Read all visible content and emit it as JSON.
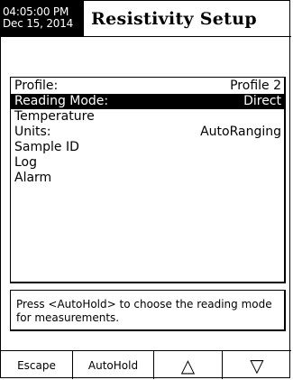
{
  "header": {
    "time": "04:05:00 PM",
    "date": "Dec 15, 2014",
    "title": "Resistivity Setup"
  },
  "menu": {
    "items": [
      {
        "label": "Profile:",
        "value": "Profile 2",
        "selected": false
      },
      {
        "label": "Reading Mode:",
        "value": "Direct",
        "selected": true
      },
      {
        "label": "Temperature",
        "value": "",
        "selected": false
      },
      {
        "label": "Units:",
        "value": "AutoRanging",
        "selected": false
      },
      {
        "label": "Sample ID",
        "value": "",
        "selected": false
      },
      {
        "label": "Log",
        "value": "",
        "selected": false
      },
      {
        "label": "Alarm",
        "value": "",
        "selected": false
      }
    ]
  },
  "help": {
    "text": "Press <AutoHold> to choose the reading mode for measurements."
  },
  "softkeys": {
    "escape": "Escape",
    "autohold": "AutoHold",
    "up": "△",
    "down": "▽"
  }
}
